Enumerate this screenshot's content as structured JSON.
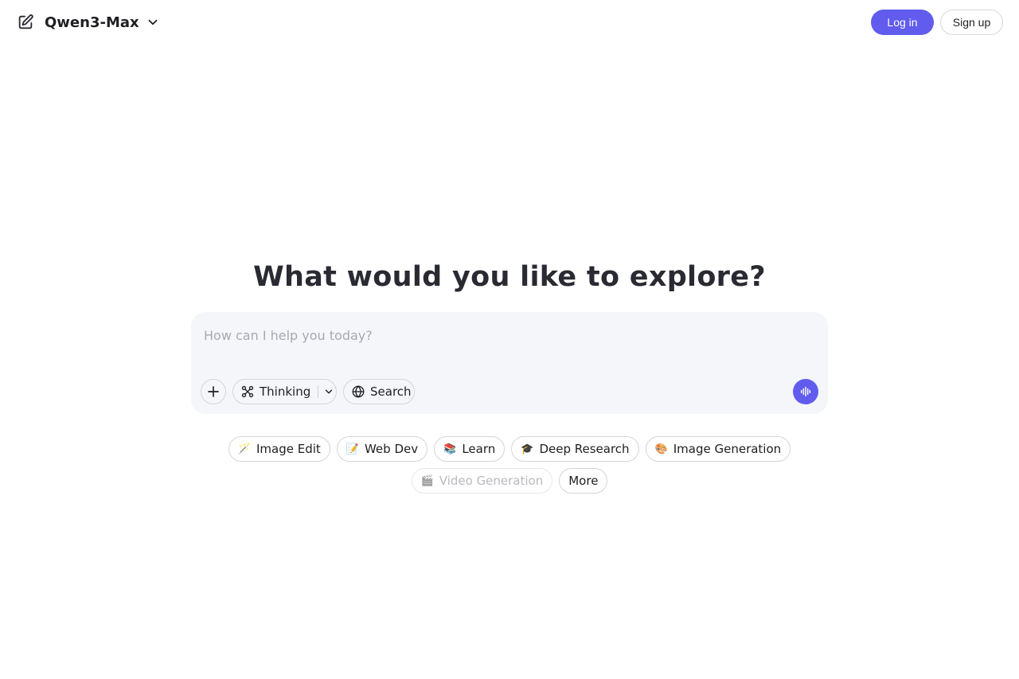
{
  "header": {
    "new_chat_icon": "edit-icon",
    "model_name": "Qwen3-Max",
    "login_label": "Log in",
    "signup_label": "Sign up"
  },
  "main": {
    "headline": "What would you like to explore?",
    "input_placeholder": "How can I help you today?",
    "input_value": "",
    "tools": {
      "thinking_label": "Thinking",
      "search_label": "Search"
    },
    "accent_color": "#615ced"
  },
  "chips": [
    {
      "emoji": "🪄",
      "label": "Image Edit"
    },
    {
      "emoji": "📝",
      "label": "Web Dev"
    },
    {
      "emoji": "📚",
      "label": "Learn"
    },
    {
      "emoji": "🎓",
      "label": "Deep Research"
    },
    {
      "emoji": "🎨",
      "label": "Image Generation"
    },
    {
      "emoji": "🎬",
      "label": "Video Generation"
    },
    {
      "emoji": "",
      "label": "More"
    }
  ]
}
